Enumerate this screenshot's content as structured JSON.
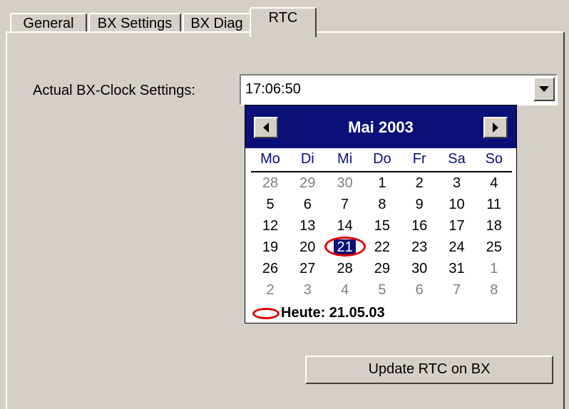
{
  "tabs": [
    {
      "label": "General",
      "active": false
    },
    {
      "label": "BX Settings",
      "active": false
    },
    {
      "label": "BX Diag",
      "active": false
    },
    {
      "label": "RTC",
      "active": true
    }
  ],
  "rtc": {
    "label": "Actual BX-Clock Settings:",
    "time_value": "17:06:50",
    "update_button": "Update RTC on BX"
  },
  "calendar": {
    "title": "Mai 2003",
    "weekdays": [
      "Mo",
      "Di",
      "Mi",
      "Do",
      "Fr",
      "Sa",
      "So"
    ],
    "weeks": [
      [
        {
          "d": "28",
          "o": true
        },
        {
          "d": "29",
          "o": true
        },
        {
          "d": "30",
          "o": true
        },
        {
          "d": "1"
        },
        {
          "d": "2"
        },
        {
          "d": "3"
        },
        {
          "d": "4"
        }
      ],
      [
        {
          "d": "5"
        },
        {
          "d": "6"
        },
        {
          "d": "7"
        },
        {
          "d": "8"
        },
        {
          "d": "9"
        },
        {
          "d": "10"
        },
        {
          "d": "11"
        }
      ],
      [
        {
          "d": "12"
        },
        {
          "d": "13"
        },
        {
          "d": "14"
        },
        {
          "d": "15"
        },
        {
          "d": "16"
        },
        {
          "d": "17"
        },
        {
          "d": "18"
        }
      ],
      [
        {
          "d": "19"
        },
        {
          "d": "20"
        },
        {
          "d": "21",
          "s": true
        },
        {
          "d": "22"
        },
        {
          "d": "23"
        },
        {
          "d": "24"
        },
        {
          "d": "25"
        }
      ],
      [
        {
          "d": "26"
        },
        {
          "d": "27"
        },
        {
          "d": "28"
        },
        {
          "d": "29"
        },
        {
          "d": "30"
        },
        {
          "d": "31"
        },
        {
          "d": "1",
          "o": true
        }
      ],
      [
        {
          "d": "2",
          "o": true
        },
        {
          "d": "3",
          "o": true
        },
        {
          "d": "4",
          "o": true
        },
        {
          "d": "5",
          "o": true
        },
        {
          "d": "6",
          "o": true
        },
        {
          "d": "7",
          "o": true
        },
        {
          "d": "8",
          "o": true
        }
      ]
    ],
    "today_text": "Heute: 21.05.03"
  },
  "colors": {
    "header_bg": "#0a1078",
    "today_circle": "#e00000",
    "window_bg": "#d4d0c8"
  }
}
